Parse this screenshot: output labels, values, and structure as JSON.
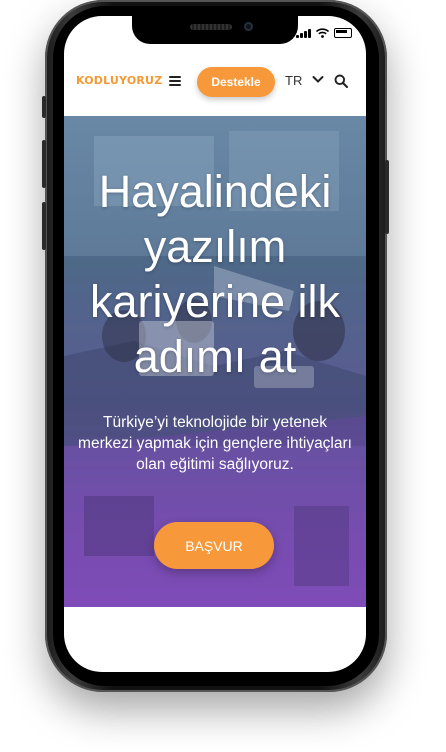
{
  "nav": {
    "logo": "KODLUYORUZ",
    "donate_label": "Destekle",
    "language": "TR"
  },
  "hero": {
    "title": "Hayalindeki yazılım kariyerine ilk adımı at",
    "subtitle": "Türkiye’yi teknolojide bir yetenek merkezi yapmak için gençlere ihtiyaçları olan eğitimi sağlıyoruz.",
    "apply_label": "BAŞVUR"
  },
  "colors": {
    "accent": "#f7993a",
    "logo": "#f29a35",
    "hero_overlay_top": "#5d7f9d",
    "hero_overlay_bottom": "#8a4fc1"
  },
  "icons": [
    "signal-icon",
    "wifi-icon",
    "battery-icon",
    "menu-icon",
    "chevron-down-icon",
    "search-icon"
  ]
}
